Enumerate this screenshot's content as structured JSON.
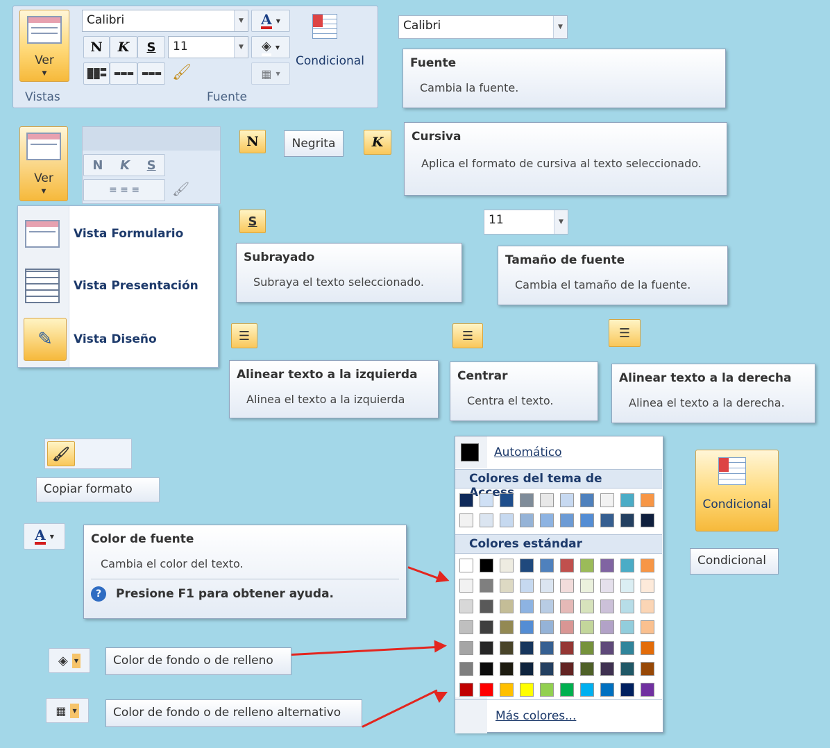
{
  "ribbon": {
    "view_label": "Ver",
    "group_vistas": "Vistas",
    "group_fuente": "Fuente",
    "font_name": "Calibri",
    "font_size": "11",
    "bold_glyph": "N",
    "italic_glyph": "K",
    "underline_glyph": "S",
    "conditional_label": "Condicional"
  },
  "font_combo": {
    "value": "Calibri"
  },
  "tip_fuente": {
    "title": "Fuente",
    "desc": "Cambia la fuente."
  },
  "negrita_label": "Negrita",
  "tip_cursiva": {
    "title": "Cursiva",
    "desc": "Aplica el formato de cursiva al texto seleccionado."
  },
  "size_combo": {
    "value": "11"
  },
  "tip_subrayado": {
    "title": "Subrayado",
    "desc": "Subraya el texto seleccionado."
  },
  "tip_tamano": {
    "title": "Tamaño de fuente",
    "desc": "Cambia el tamaño de la fuente."
  },
  "view_menu": {
    "button_label": "Ver",
    "items": [
      {
        "pre": "Vista Formulari",
        "u": "",
        "label": "Vista Formulario",
        "icon": "form-view-icon"
      },
      {
        "label": "Vista Presentación",
        "icon": "layout-view-icon"
      },
      {
        "label": "Vista Diseño",
        "icon": "design-view-icon"
      }
    ]
  },
  "tip_izquierda": {
    "title": "Alinear texto a la izquierda",
    "desc": "Alinea el texto a la izquierda"
  },
  "tip_centrar": {
    "title": "Centrar",
    "desc": "Centra el texto."
  },
  "tip_derecha": {
    "title": "Alinear texto a la derecha",
    "desc": "Alinea el texto a la derecha."
  },
  "copiar_formato": "Copiar formato",
  "tip_color_fuente": {
    "title": "Color de fuente",
    "desc": "Cambia el color del texto.",
    "help": "Presione F1 para obtener ayuda."
  },
  "color_fondo_label": "Color de fondo o de relleno",
  "color_fondo_alt_label": "Color de fondo o de relleno alternativo",
  "palette": {
    "automatic": "Automático",
    "theme_header": "Colores del tema de Access",
    "standard_header": "Colores estándar",
    "more_colors": "Más colores...",
    "theme_row1": [
      "#0f2a5a",
      "#cfe0f5",
      "#1f4e8c",
      "#7f8c99",
      "#e8e8e8",
      "#c7d9f1",
      "#4f81bd",
      "#f2f2f2",
      "#4bacc6",
      "#f79646"
    ],
    "theme_row2": [
      "#f2f2f2",
      "#dbe5f1",
      "#c6d9f0",
      "#95b3d7",
      "#8db3e2",
      "#6c9bd5",
      "#548dd4",
      "#365f91",
      "#244061",
      "#0f1f3d"
    ],
    "standard_rows": [
      [
        "#ffffff",
        "#000000",
        "#eeece1",
        "#1f497d",
        "#4f81bd",
        "#c0504d",
        "#9bbb59",
        "#8064a2",
        "#4bacc6",
        "#f79646"
      ],
      [
        "#f2f2f2",
        "#7f7f7f",
        "#ddd9c3",
        "#c6d9f0",
        "#dbe5f1",
        "#f2dcdb",
        "#ebf1dd",
        "#e5e0ec",
        "#dbeef3",
        "#fdeada"
      ],
      [
        "#d8d8d8",
        "#595959",
        "#c4bd97",
        "#8db3e2",
        "#b8cce4",
        "#e5b9b7",
        "#d7e3bc",
        "#ccc1d9",
        "#b7dde8",
        "#fbd5b5"
      ],
      [
        "#bfbfbf",
        "#3f3f3f",
        "#938953",
        "#548dd4",
        "#95b3d7",
        "#d99694",
        "#c3d69b",
        "#b2a2c7",
        "#92cddc",
        "#fac08f"
      ],
      [
        "#a5a5a5",
        "#262626",
        "#494429",
        "#17365d",
        "#366092",
        "#953734",
        "#76923c",
        "#5f497a",
        "#31859b",
        "#e36c09"
      ],
      [
        "#7f7f7f",
        "#0c0c0c",
        "#1d1b10",
        "#0f243e",
        "#244061",
        "#632423",
        "#4f6128",
        "#3f3151",
        "#205867",
        "#974806"
      ],
      [
        "#c00000",
        "#ff0000",
        "#ffc000",
        "#ffff00",
        "#92d050",
        "#00b050",
        "#00b0f0",
        "#0070c0",
        "#002060",
        "#7030a0"
      ]
    ]
  },
  "conditional_big_label": "Condicional",
  "conditional_tip_label": "Condicional"
}
